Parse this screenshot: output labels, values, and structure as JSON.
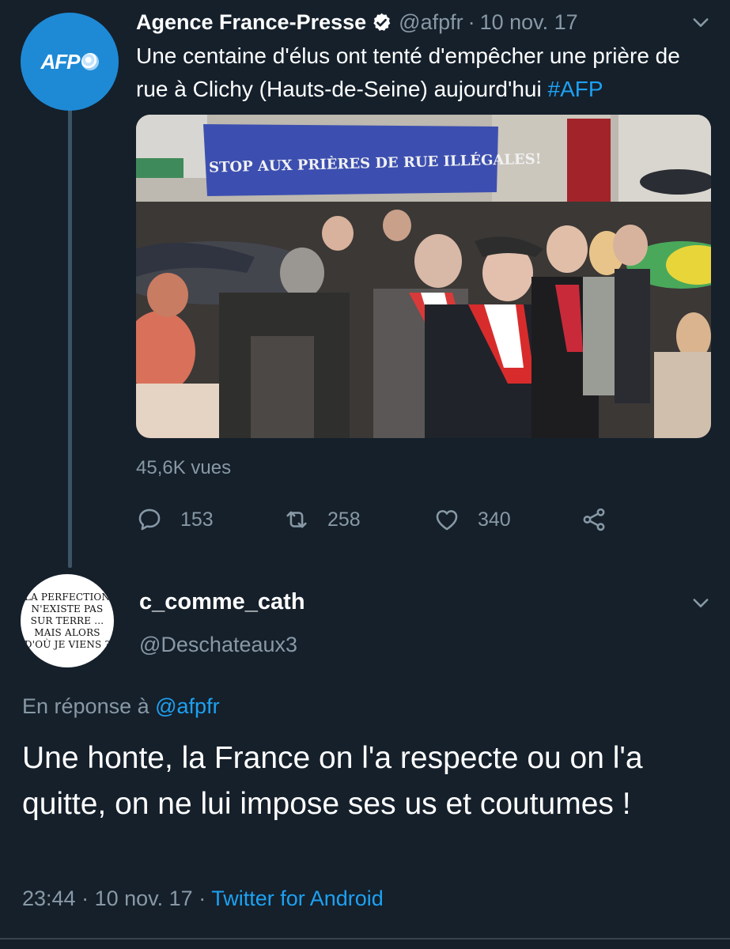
{
  "tweet": {
    "author_name": "Agence France-Presse",
    "handle": "@afpfr",
    "separator": "·",
    "date": "10 nov. 17",
    "avatar_logo_text": "AFP",
    "text": "Une centaine d'élus ont tenté d'empêcher une prière de rue à Clichy (Hauts-de-Seine) aujourd'hui ",
    "hashtag": "#AFP",
    "media": {
      "banner_text": "STOP AUX PRIÈRES DE RUE ILLÉGALES!"
    },
    "views": "45,6K vues",
    "actions": {
      "replies": "153",
      "retweets": "258",
      "likes": "340"
    }
  },
  "reply": {
    "author_name": "c_comme_cath",
    "handle": "@Deschateaux3",
    "avatar_text": [
      "LA PERFECTION",
      "N'EXISTE PAS",
      "SUR TERRE ...",
      "MAIS ALORS",
      "D'OÙ JE VIENS ?"
    ],
    "in_reply_label": "En réponse à ",
    "in_reply_handle": "@afpfr",
    "text": "Une honte, la France on l'a respecte ou on l'a quitte, on ne lui impose ses us et coutumes !",
    "time": "23:44",
    "separator": " · ",
    "date": "10 nov. 17",
    "source": "Twitter for Android"
  },
  "icons": {
    "verified": "verified-badge-icon",
    "chevron": "chevron-down-icon",
    "reply": "reply-icon",
    "retweet": "retweet-icon",
    "like": "heart-icon",
    "share": "share-icon"
  },
  "colors": {
    "background": "#15202b",
    "link": "#1da1f2",
    "secondary_text": "#8899a6",
    "afp_blue": "#1e8ad6"
  }
}
